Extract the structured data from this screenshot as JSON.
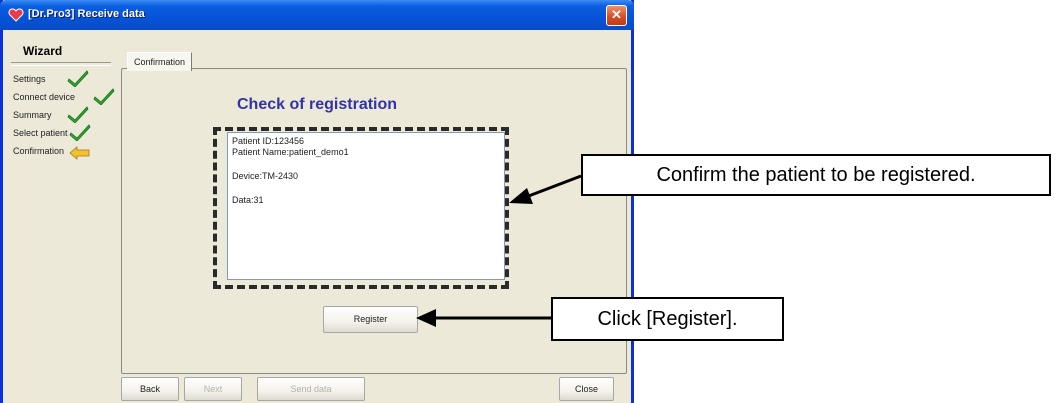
{
  "window": {
    "title": "[Dr.Pro3] Receive data",
    "close_glyph": "✕"
  },
  "wizard": {
    "title": "Wizard",
    "steps": [
      {
        "label": "Settings",
        "status": "done"
      },
      {
        "label": "Connect device",
        "status": "done"
      },
      {
        "label": "Summary",
        "status": "done"
      },
      {
        "label": "Select patient",
        "status": "done"
      },
      {
        "label": "Confirmation",
        "status": "current"
      }
    ]
  },
  "tabs": {
    "active": "Confirmation"
  },
  "main": {
    "heading": "Check of registration",
    "info": {
      "patient_id": "Patient ID:123456",
      "patient_name": "Patient Name:patient_demo1",
      "device": "Device:TM-2430",
      "data": "Data:31"
    },
    "register_label": "Register"
  },
  "footer": {
    "back_label": "Back",
    "next_label": "Next",
    "send_label": "Send data",
    "close_label": "Close"
  },
  "callouts": {
    "confirm": "Confirm the patient to be registered.",
    "register": "Click [Register]."
  },
  "colors": {
    "title_bar": "#0653d8",
    "heading": "#3333a8",
    "check": "#2fa82f",
    "current_arrow": "#f2c230"
  }
}
